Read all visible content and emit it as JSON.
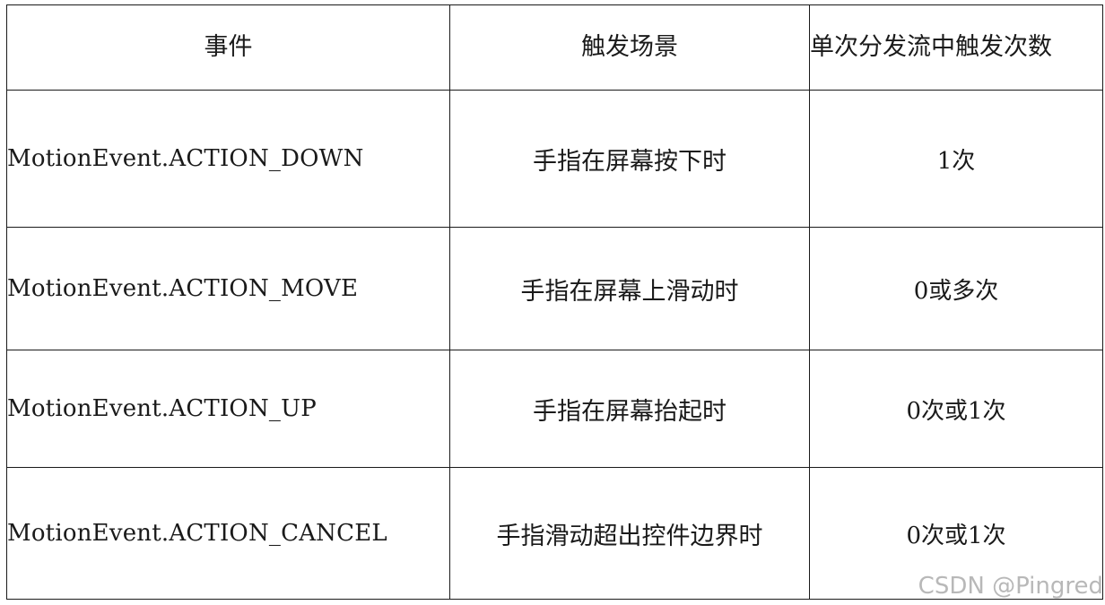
{
  "table": {
    "headers": {
      "event": "事件",
      "scene": "触发场景",
      "count": "单次分发流中触发次数"
    },
    "rows": [
      {
        "event": "MotionEvent.ACTION_DOWN",
        "scene": "手指在屏幕按下时",
        "count": "1次"
      },
      {
        "event": "MotionEvent.ACTION_MOVE",
        "scene": "手指在屏幕上滑动时",
        "count": "0或多次"
      },
      {
        "event": "MotionEvent.ACTION_UP",
        "scene": "手指在屏幕抬起时",
        "count": "0次或1次"
      },
      {
        "event": "MotionEvent.ACTION_CANCEL",
        "scene": "手指滑动超出控件边界时",
        "count": "0次或1次"
      }
    ]
  },
  "watermark": "CSDN @Pingred"
}
